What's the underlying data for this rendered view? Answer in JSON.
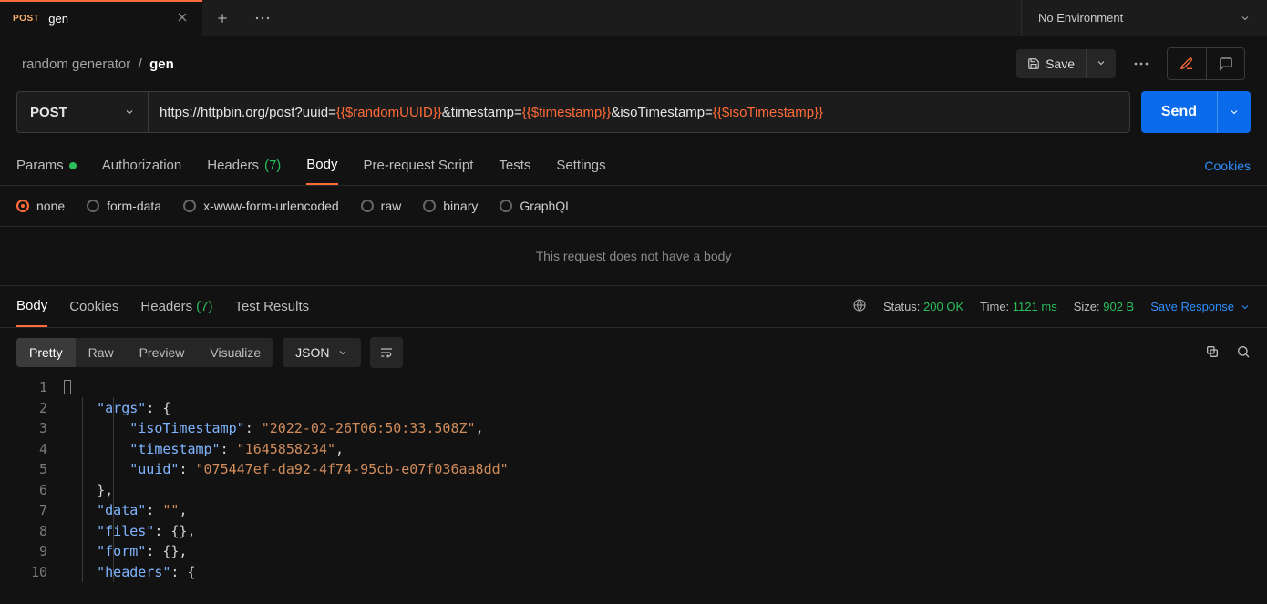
{
  "tab": {
    "method": "POST",
    "title": "gen"
  },
  "env": {
    "label": "No Environment"
  },
  "crumbs": {
    "collection": "random generator",
    "request": "gen"
  },
  "toolbar": {
    "save": "Save"
  },
  "request": {
    "method": "POST",
    "url_parts": [
      {
        "t": "https://httpbin.org/post?uuid=",
        "v": false
      },
      {
        "t": "{{$randomUUID}}",
        "v": true
      },
      {
        "t": "&timestamp=",
        "v": false
      },
      {
        "t": "{{$timestamp}}",
        "v": true
      },
      {
        "t": "&isoTimestamp=",
        "v": false
      },
      {
        "t": "{{$isoTimestamp}}",
        "v": true
      }
    ],
    "send": "Send"
  },
  "req_tabs": {
    "params": "Params",
    "auth": "Authorization",
    "headers": "Headers",
    "headers_count": "(7)",
    "body": "Body",
    "prereq": "Pre-request Script",
    "tests": "Tests",
    "settings": "Settings",
    "cookies": "Cookies"
  },
  "body_types": {
    "none": "none",
    "form": "form-data",
    "xform": "x-www-form-urlencoded",
    "raw": "raw",
    "binary": "binary",
    "graphql": "GraphQL"
  },
  "body_msg": "This request does not have a body",
  "res_tabs": {
    "body": "Body",
    "cookies": "Cookies",
    "headers": "Headers",
    "headers_count": "(7)",
    "tests": "Test Results"
  },
  "status": {
    "status_label": "Status:",
    "status_value": "200 OK",
    "time_label": "Time:",
    "time_value": "1121 ms",
    "size_label": "Size:",
    "size_value": "902 B",
    "save": "Save Response"
  },
  "view": {
    "pretty": "Pretty",
    "raw": "Raw",
    "preview": "Preview",
    "visualize": "Visualize",
    "fmt": "JSON"
  },
  "code": {
    "gutter": [
      "1",
      "2",
      "3",
      "4",
      "5",
      "6",
      "7",
      "8",
      "9",
      "10"
    ],
    "tokens": [
      [],
      [
        [
          "k",
          "\"args\""
        ],
        [
          "p",
          ": {"
        ]
      ],
      [
        [
          "k",
          "\"isoTimestamp\""
        ],
        [
          "p",
          ": "
        ],
        [
          "s",
          "\"2022-02-26T06:50:33.508Z\""
        ],
        [
          "p",
          ","
        ]
      ],
      [
        [
          "k",
          "\"timestamp\""
        ],
        [
          "p",
          ": "
        ],
        [
          "s",
          "\"1645858234\""
        ],
        [
          "p",
          ","
        ]
      ],
      [
        [
          "k",
          "\"uuid\""
        ],
        [
          "p",
          ": "
        ],
        [
          "s",
          "\"075447ef-da92-4f74-95cb-e07f036aa8dd\""
        ]
      ],
      [
        [
          "p",
          "},"
        ]
      ],
      [
        [
          "k",
          "\"data\""
        ],
        [
          "p",
          ": "
        ],
        [
          "s",
          "\"\""
        ],
        [
          "p",
          ","
        ]
      ],
      [
        [
          "k",
          "\"files\""
        ],
        [
          "p",
          ": {},"
        ]
      ],
      [
        [
          "k",
          "\"form\""
        ],
        [
          "p",
          ": {},"
        ]
      ],
      [
        [
          "k",
          "\"headers\""
        ],
        [
          "p",
          ": {"
        ]
      ]
    ],
    "indents": [
      0,
      1,
      2,
      2,
      2,
      1,
      1,
      1,
      1,
      1
    ]
  }
}
